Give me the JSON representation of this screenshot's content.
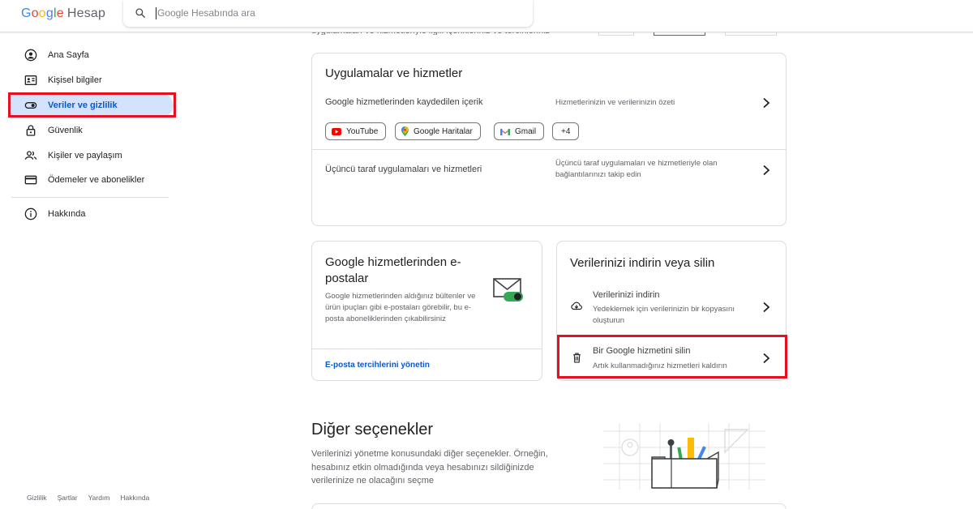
{
  "header": {
    "logo_parts": [
      "G",
      "o",
      "o",
      "g",
      "l",
      "e"
    ],
    "product": "Hesap",
    "search_placeholder": "Google Hesabında ara"
  },
  "sidebar": {
    "items": [
      {
        "label": "Ana Sayfa",
        "icon": "home-account-icon"
      },
      {
        "label": "Kişisel bilgiler",
        "icon": "id-card-icon"
      },
      {
        "label": "Veriler ve gizlilik",
        "icon": "toggle-icon",
        "active": true
      },
      {
        "label": "Güvenlik",
        "icon": "lock-icon"
      },
      {
        "label": "Kişiler ve paylaşım",
        "icon": "people-icon"
      },
      {
        "label": "Ödemeler ve abonelikler",
        "icon": "credit-card-icon"
      },
      {
        "label": "Hakkında",
        "icon": "info-icon"
      }
    ]
  },
  "footer": {
    "links": [
      "Gizlilik",
      "Şartlar",
      "Yardım",
      "Hakkında"
    ]
  },
  "top_strip": {
    "text": "uygulamaları ve hizmetleriyle ilgili içerikleriniz ve tercihleriniz"
  },
  "apps_card": {
    "title": "Uygulamalar ve hizmetler",
    "row1_label": "Google hizmetlerinden kaydedilen içerik",
    "row1_desc": "Hizmetlerinizin ve verilerinizin özeti",
    "chips": [
      "YouTube",
      "Google Haritalar",
      "Gmail",
      "+4"
    ],
    "row2_label": "Üçüncü taraf uygulamaları ve hizmetleri",
    "row2_desc": "Üçüncü taraf uygulamaları ve hizmetleriyle olan bağlantılarınızı takip edin"
  },
  "email_card": {
    "title": "Google hizmetlerinden e-postalar",
    "desc": "Google hizmetlerinden aldığınız bültenler ve ürün ipuçları gibi e-postaları görebilir, bu e-posta aboneliklerinden çıkabilirsiniz",
    "link": "E-posta tercihlerini yönetin"
  },
  "data_card": {
    "title": "Verilerinizi indirin veya silin",
    "download_label": "Verilerinizi indirin",
    "download_desc": "Yedeklemek için verilerinizin bir kopyasını oluşturun",
    "delete_label": "Bir Google hizmetini silin",
    "delete_desc": "Artık kullanmadığınız hizmetleri kaldırın"
  },
  "other_section": {
    "title": "Diğer seçenekler",
    "desc": "Verilerinizi yönetme konusundaki diğer seçenekler. Örneğin, hesabınız etkin olmadığında veya hesabınızı sildiğinizde verilerinize ne olacağını seçme"
  },
  "colors": {
    "highlight_red": "#e8101f",
    "active_bg": "#d3e3fd",
    "link_blue": "#0b57d0"
  }
}
